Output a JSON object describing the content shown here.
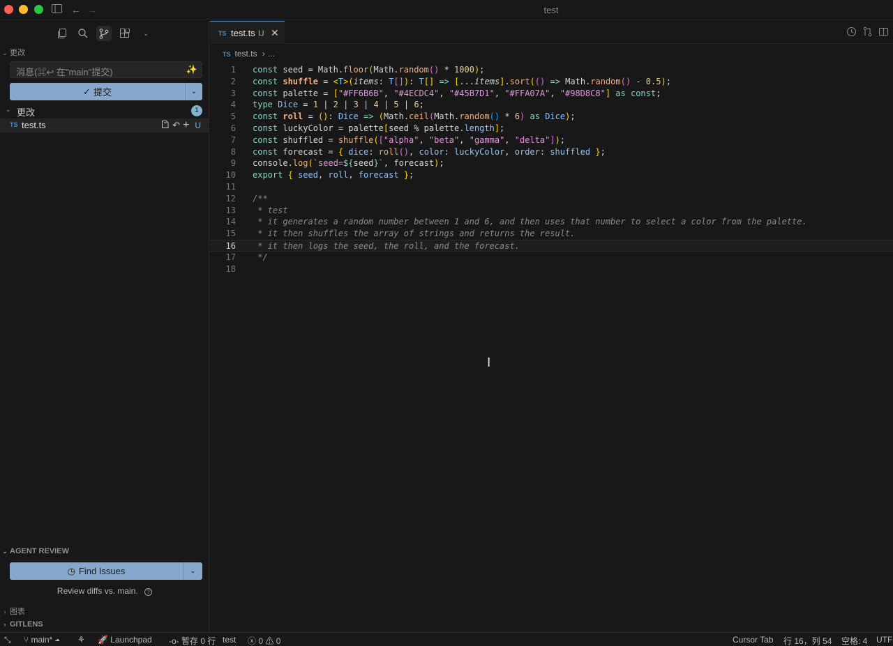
{
  "window": {
    "title": "test"
  },
  "sidebar": {
    "changes_section_title": "更改",
    "message_placeholder": "消息(⌘↩ 在\"main\"提交)",
    "commit_label": "提交",
    "changes_group_label": "更改",
    "changes_count": "1",
    "files": [
      {
        "lang": "TS",
        "name": "test.ts",
        "status": "U"
      }
    ],
    "agent_review_title": "AGENT REVIEW",
    "find_issues_label": "Find Issues",
    "review_note": "Review diffs vs. main.",
    "graph_title": "图表",
    "gitlens_title": "GITLENS"
  },
  "editor": {
    "tab": {
      "lang": "TS",
      "name": "test.ts",
      "status": "U"
    },
    "breadcrumb": {
      "lang": "TS",
      "file": "test.ts",
      "rest": "..."
    },
    "current_line": 16
  },
  "statusbar": {
    "branch": "main*",
    "launchpad": "Launchpad",
    "stash": "暂存 0 行",
    "project": "test",
    "errors": "0",
    "warnings": "0",
    "cursor_tab": "Cursor Tab",
    "position": "行 16，列 54",
    "spaces": "空格: 4",
    "encoding": "UTF-"
  },
  "colors": {
    "accent_button": "#87a8cc",
    "badge": "#7fb5d0",
    "ts_icon": "#4a8fc9"
  }
}
